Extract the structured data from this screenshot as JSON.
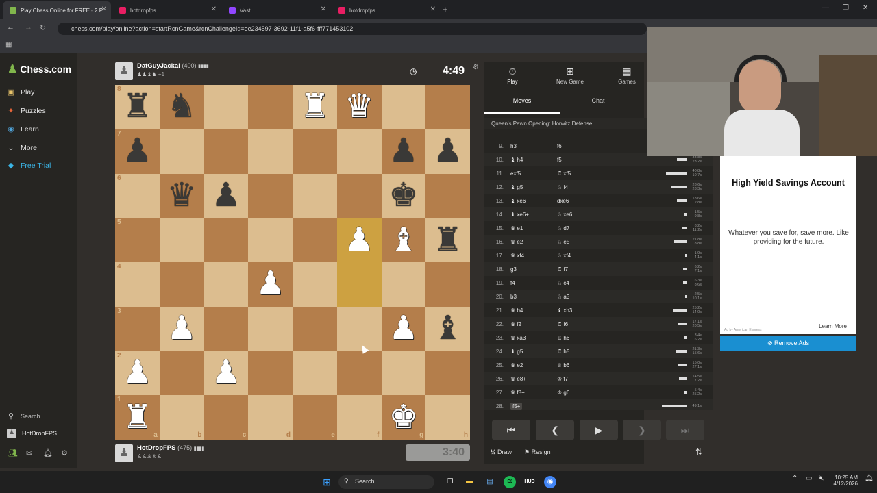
{
  "browser": {
    "tabs": [
      {
        "title": "Play Chess Online for FREE - 2 P",
        "color": "#81b64c"
      },
      {
        "title": "hotdropfps",
        "color": "#e91e63"
      },
      {
        "title": "Vast",
        "color": "#9146ff"
      },
      {
        "title": "hotdropfps",
        "color": "#e91e63"
      }
    ],
    "url": "chess.com/play/online?action=startRcnGame&rcnChallengeId=ee234597-3692-11f1-a5f6-fff771453102"
  },
  "sidebar": {
    "brand": "Chess.com",
    "items": [
      {
        "label": "Play",
        "icon": "play-board-icon",
        "color": "#e8c36a"
      },
      {
        "label": "Puzzles",
        "icon": "puzzle-icon",
        "color": "#e8663a"
      },
      {
        "label": "Learn",
        "icon": "learn-icon",
        "color": "#4fa3d9"
      },
      {
        "label": "More",
        "icon": "chevron-down-icon",
        "color": "#cccccc"
      },
      {
        "label": "Free Trial",
        "icon": "diamond-icon",
        "color": "#3bb5e6"
      }
    ],
    "search_label": "Search",
    "user_label": "HotDropFPS"
  },
  "top_player": {
    "name": "DatGuyJackal",
    "rating": "(400)",
    "material": "+1",
    "clock": "4:49"
  },
  "bottom_player": {
    "name": "HotDropFPS",
    "rating": "(475)",
    "clock": "3:40"
  },
  "board": {
    "ranks": [
      "8",
      "7",
      "6",
      "5",
      "4",
      "3",
      "2",
      "1"
    ],
    "files": [
      "a",
      "b",
      "c",
      "d",
      "e",
      "f",
      "g",
      "h"
    ],
    "highlight": [
      "f5",
      "f4"
    ],
    "position": {
      "a8": "bR",
      "b8": "bN",
      "e8": "wR",
      "f8": "wQ",
      "a7": "bP",
      "g7": "bP",
      "h7": "bP",
      "b6": "bQ",
      "c6": "bP",
      "g6": "bK",
      "f5": "wP",
      "g5": "wB",
      "h5": "bR",
      "d4": "wP",
      "b3": "wP",
      "g3": "wP",
      "h3": "bB",
      "a2": "wP",
      "c2": "wP",
      "a1": "wR",
      "g1": "wK"
    }
  },
  "panel": {
    "tabs": [
      {
        "label": "Play",
        "icon": "timer-icon"
      },
      {
        "label": "New Game",
        "icon": "plus-icon"
      },
      {
        "label": "Games",
        "icon": "board-grid-icon"
      }
    ],
    "subtabs": [
      "Moves",
      "Chat"
    ],
    "opening": "Queen's Pawn Opening: Horwitz Defense",
    "moves": [
      {
        "n": "9.",
        "w": "h3",
        "wp": "",
        "b": "f6",
        "bp": "",
        "t": [
          "",
          ""
        ],
        "bar": 0
      },
      {
        "n": "10.",
        "w": "h4",
        "wp": "♝",
        "b": "f5",
        "bp": "",
        "t": [
          "33.8s",
          "23.2s"
        ],
        "bar": 14
      },
      {
        "n": "11.",
        "w": "exf5",
        "wp": "",
        "b": "xf5",
        "bp": "♖",
        "t": [
          "40.8s",
          "10.7s"
        ],
        "bar": 30
      },
      {
        "n": "12.",
        "w": "g5",
        "wp": "♝",
        "b": "f4",
        "bp": "♘",
        "t": [
          "28.6s",
          "28.3s"
        ],
        "bar": 22
      },
      {
        "n": "13.",
        "w": "xe6",
        "wp": "♝",
        "b": "dxe6",
        "bp": "",
        "t": [
          "18.6s",
          "2.8s"
        ],
        "bar": 14
      },
      {
        "n": "14.",
        "w": "xe6+",
        "wp": "♝",
        "b": "xe6",
        "bp": "♘",
        "t": [
          "1.5s",
          "9.8s"
        ],
        "bar": 4
      },
      {
        "n": "15.",
        "w": "e1",
        "wp": "♛",
        "b": "d7",
        "bp": "♘",
        "t": [
          "8.2s",
          "11.2s"
        ],
        "bar": 6
      },
      {
        "n": "16.",
        "w": "e2",
        "wp": "♛",
        "b": "e5",
        "bp": "♘",
        "t": [
          "21.8s",
          "8.8s"
        ],
        "bar": 18
      },
      {
        "n": "17.",
        "w": "xf4",
        "wp": "♛",
        "b": "xf4",
        "bp": "♘",
        "t": [
          "1.9s",
          "4.1s"
        ],
        "bar": 2
      },
      {
        "n": "18.",
        "w": "g3",
        "wp": "",
        "b": "f7",
        "bp": "♖",
        "t": [
          "6.2s",
          "7.1s"
        ],
        "bar": 5
      },
      {
        "n": "19.",
        "w": "f4",
        "wp": "",
        "b": "c4",
        "bp": "♘",
        "t": [
          "6.3s",
          "8.6s"
        ],
        "bar": 5
      },
      {
        "n": "20.",
        "w": "b3",
        "wp": "",
        "b": "a3",
        "bp": "♘",
        "t": [
          "2.5s",
          "10.1s"
        ],
        "bar": 2
      },
      {
        "n": "21.",
        "w": "b4",
        "wp": "♛",
        "b": "xh3",
        "bp": "♝",
        "t": [
          "25.2s",
          "14.0s"
        ],
        "bar": 20
      },
      {
        "n": "22.",
        "w": "f2",
        "wp": "♛",
        "b": "f6",
        "bp": "♖",
        "t": [
          "17.1s",
          "20.5s"
        ],
        "bar": 13
      },
      {
        "n": "23.",
        "w": "xa3",
        "wp": "♛",
        "b": "h6",
        "bp": "♖",
        "t": [
          "3.4s",
          "6.2s"
        ],
        "bar": 3
      },
      {
        "n": "24.",
        "w": "g5",
        "wp": "♝",
        "b": "h5",
        "bp": "♖",
        "t": [
          "21.3s",
          "15.6s"
        ],
        "bar": 16
      },
      {
        "n": "25.",
        "w": "e2",
        "wp": "♛",
        "b": "b6",
        "bp": "♕",
        "t": [
          "15.0s",
          "27.1s"
        ],
        "bar": 12
      },
      {
        "n": "26.",
        "w": "e8+",
        "wp": "♛",
        "b": "f7",
        "bp": "♔",
        "t": [
          "14.5s",
          "7.2s"
        ],
        "bar": 11
      },
      {
        "n": "27.",
        "w": "f8+",
        "wp": "♛",
        "b": "g6",
        "bp": "♔",
        "t": [
          "5.4s",
          "25.2s"
        ],
        "bar": 4
      },
      {
        "n": "28.",
        "w": "f5+",
        "wp": "",
        "b": "",
        "bp": "",
        "t": [
          "49.1s",
          ""
        ],
        "bar": 36
      }
    ],
    "draw_label": "Draw",
    "resign_label": "Resign"
  },
  "ad": {
    "title": "High Yield Savings Account",
    "body": "Whatever you save for, save more. Like providing for the future.",
    "by": "Ad by American Express",
    "learn": "Learn More",
    "remove": "Remove Ads"
  },
  "taskbar": {
    "search": "Search",
    "time": "10:25 AM",
    "date": "4/12/2026"
  }
}
